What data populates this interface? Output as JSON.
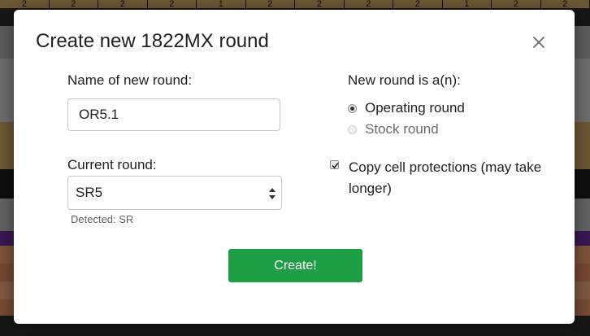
{
  "dialog": {
    "title": "Create new 1822MX round",
    "close_icon": "close-icon"
  },
  "form": {
    "name_label": "Name of new round:",
    "name_value": "OR5.1",
    "current_label": "Current round:",
    "current_value": "SR5",
    "detected_text": "Detected: SR",
    "type_label": "New round is a(n):",
    "options": [
      {
        "label": "Operating round",
        "checked": true,
        "disabled": false
      },
      {
        "label": "Stock round",
        "checked": false,
        "disabled": true
      }
    ],
    "copy_label": "Copy cell protections (may take longer)",
    "copy_checked": true,
    "create_label": "Create!"
  },
  "background": {
    "top_row": [
      "2",
      "2",
      "2",
      "2",
      "1",
      "2",
      "2",
      "2",
      "2",
      "1",
      "2",
      "2"
    ]
  },
  "colors": {
    "accent": "#1e9e45",
    "sheet_tan": "#c9a15f",
    "sheet_purple": "#6a2d9a",
    "sheet_orange": "#d9835a"
  }
}
